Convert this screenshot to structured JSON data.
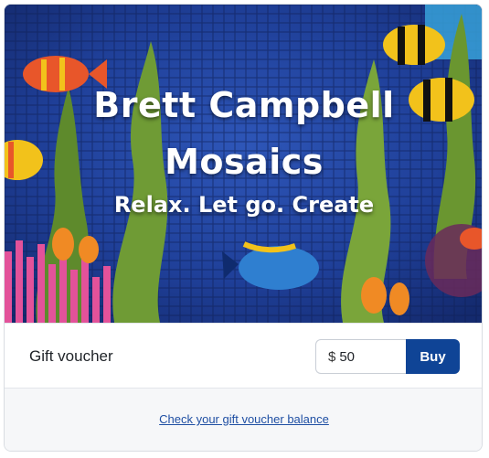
{
  "banner": {
    "title_line1": "Brett Campbell",
    "title_line2": "Mosaics",
    "tagline": "Relax. Let go. Create",
    "colors": {
      "sea": "#1e3a8c",
      "seaweed": "#7aa53a",
      "fish_yellow": "#f2c21b",
      "fish_orange": "#e8562a",
      "coral_pink": "#e3529a"
    }
  },
  "voucher": {
    "label": "Gift voucher",
    "currency": "$",
    "amount_value": "50",
    "buy_label": "Buy",
    "accent_color": "#0f4496"
  },
  "footer": {
    "balance_link": "Check your gift voucher balance"
  }
}
